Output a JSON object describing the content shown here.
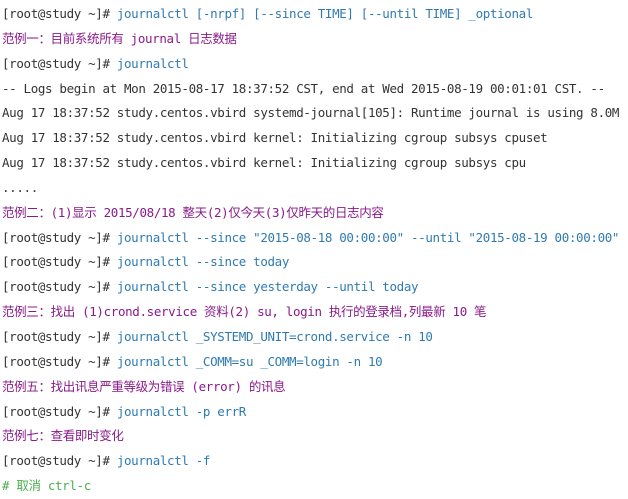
{
  "colors": {
    "prompt": "#333333",
    "command": "#2f7bb0",
    "heading": "#8a1a8a",
    "output": "#333333",
    "comment": "#4caf50"
  },
  "lines": [
    {
      "type": "command",
      "prompt": "[root@study ~]# ",
      "text": "journalctl [-nrpf] [--since TIME] [--until TIME] _optional"
    },
    {
      "type": "heading",
      "text": "范例一：目前系统所有 journal 日志数据"
    },
    {
      "type": "command",
      "prompt": "[root@study ~]# ",
      "text": "journalctl"
    },
    {
      "type": "output",
      "text": "-- Logs begin at Mon 2015-08-17 18:37:52 CST, end at Wed 2015-08-19 00:01:01 CST. --"
    },
    {
      "type": "output",
      "text": "Aug 17 18:37:52 study.centos.vbird systemd-journal[105]: Runtime journal is using 8.0M"
    },
    {
      "type": "output",
      "text": "Aug 17 18:37:52 study.centos.vbird kernel: Initializing cgroup subsys cpuset"
    },
    {
      "type": "output",
      "text": "Aug 17 18:37:52 study.centos.vbird kernel: Initializing cgroup subsys cpu"
    },
    {
      "type": "output",
      "text": "....."
    },
    {
      "type": "heading",
      "text": "范例二：(1)显示 2015/08/18 整天(2)仅今天(3)仅昨天的日志内容"
    },
    {
      "type": "command",
      "prompt": "[root@study ~]# ",
      "text": "journalctl --since \"2015-08-18 00:00:00\" --until \"2015-08-19 00:00:00\""
    },
    {
      "type": "command",
      "prompt": "[root@study ~]# ",
      "text": "journalctl --since today"
    },
    {
      "type": "command",
      "prompt": "[root@study ~]# ",
      "text": "journalctl --since yesterday --until today"
    },
    {
      "type": "heading",
      "text": "范例三：找出 (1)crond.service 资料(2) su, login 执行的登录档,列最新 10 笔"
    },
    {
      "type": "command",
      "prompt": "[root@study ~]# ",
      "text": "journalctl _SYSTEMD_UNIT=crond.service -n 10"
    },
    {
      "type": "command",
      "prompt": "[root@study ~]# ",
      "text": "journalctl _COMM=su _COMM=login -n 10"
    },
    {
      "type": "heading",
      "text": "范例五：找出讯息严重等级为错误 (error) 的讯息"
    },
    {
      "type": "command",
      "prompt": "[root@study ~]# ",
      "text": "journalctl -p errR"
    },
    {
      "type": "heading",
      "text": "范例七：查看即时变化"
    },
    {
      "type": "command",
      "prompt": "[root@study ~]# ",
      "text": "journalctl -f"
    },
    {
      "type": "comment",
      "text": "# 取消 ctrl-c"
    }
  ]
}
